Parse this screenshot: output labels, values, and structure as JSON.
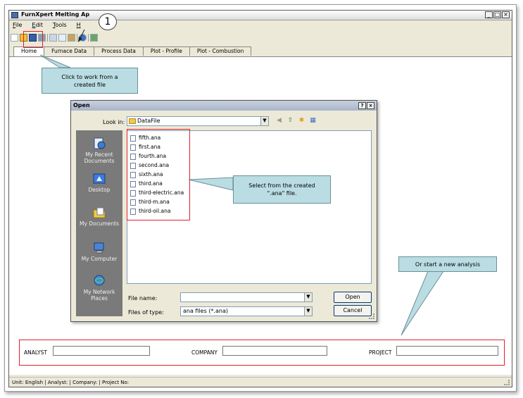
{
  "app": {
    "title": "FurnXpert Melting Ap",
    "window_buttons": [
      "_",
      "□",
      "×"
    ],
    "menu": [
      "File",
      "Edit",
      "Tools",
      "H"
    ],
    "toolbar": [
      "new-icon",
      "open-icon",
      "save-icon",
      "print-icon",
      "cut-icon",
      "copy-icon",
      "paste-icon",
      "help-icon",
      "image-icon"
    ],
    "tabs": [
      "Home",
      "Furnace Data",
      "Process Data",
      "Plot - Profile",
      "Plot - Combustion"
    ],
    "status": "Unit: English  | Analyst:   | Company:   | Project No:"
  },
  "dialog": {
    "title": "Open",
    "title_buttons": [
      "?",
      "×"
    ],
    "look_in_label": "Look in:",
    "look_in_value": "DataFile",
    "places": [
      "My Recent Documents",
      "Desktop",
      "My Documents",
      "My Computer",
      "My Network Places"
    ],
    "files": [
      "fifth.ana",
      "first.ana",
      "fourth.ana",
      "second.ana",
      "sixth.ana",
      "third.ana",
      "third-electric.ana",
      "third-m.ana",
      "third-oil.ana"
    ],
    "file_name_label": "File name:",
    "file_name_value": "",
    "file_type_label": "Files of type:",
    "file_type_value": "ana files (*.ana)",
    "open_label": "Open",
    "cancel_label": "Cancel"
  },
  "callouts": {
    "badge": "1",
    "open_file": "Click to work from a created file",
    "select_file": "Select from the created \".ana\" file.",
    "new_analysis": "Or start a new analysis"
  },
  "form": {
    "analyst_label": "ANALYST",
    "company_label": "COMPANY",
    "project_label": "PROJECT"
  },
  "colors": {
    "highlight": "#e0202a",
    "callout_fill": "#b9dde3",
    "places_bar": "#7a7a7a"
  }
}
